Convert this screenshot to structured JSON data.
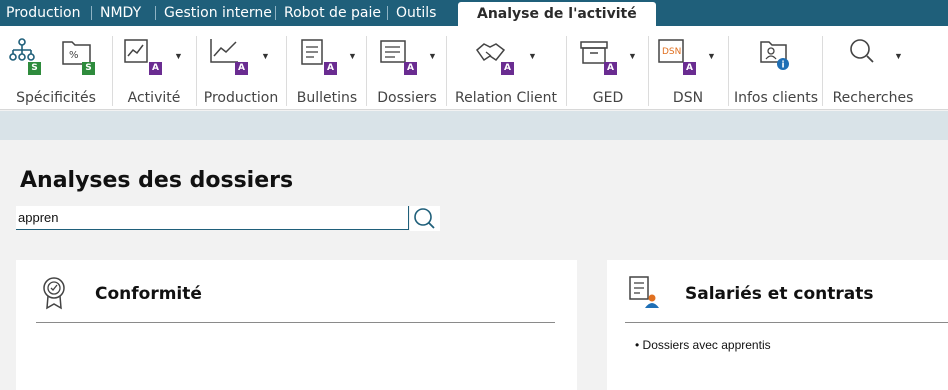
{
  "tabs": [
    {
      "label": "Production"
    },
    {
      "label": "NMDY"
    },
    {
      "label": "Gestion interne"
    },
    {
      "label": "Robot de paie"
    },
    {
      "label": "Outils"
    },
    {
      "label": "Analyse de l'activité",
      "active": true
    }
  ],
  "ribbon": {
    "groups": [
      {
        "label": "Spécificités",
        "icons": [
          "org-chart-icon",
          "percent-folder-icon"
        ],
        "badges": [
          "S",
          "S"
        ]
      },
      {
        "label": "Activité",
        "icons": [
          "activity-chart-icon"
        ],
        "badges": [
          "A"
        ]
      },
      {
        "label": "Production",
        "icons": [
          "line-chart-icon"
        ],
        "badges": [
          "A"
        ]
      },
      {
        "label": "Bulletins",
        "icons": [
          "payslip-icon"
        ],
        "badges": [
          "A"
        ]
      },
      {
        "label": "Dossiers",
        "icons": [
          "folder-list-icon"
        ],
        "badges": [
          "A"
        ]
      },
      {
        "label": "Relation Client",
        "icons": [
          "handshake-icon"
        ],
        "badges": [
          "A"
        ]
      },
      {
        "label": "GED",
        "icons": [
          "archive-box-icon"
        ],
        "badges": [
          "A"
        ]
      },
      {
        "label": "DSN",
        "icons": [
          "dsn-doc-icon"
        ],
        "badges": [
          "A"
        ],
        "icon_text": "DSN"
      },
      {
        "label": "Infos clients",
        "icons": [
          "client-folder-info-icon"
        ],
        "badges": []
      },
      {
        "label": "Recherches",
        "icons": [
          "search-icon"
        ],
        "badges": []
      }
    ]
  },
  "main": {
    "title": "Analyses des dossiers",
    "search": {
      "value": "appren",
      "placeholder": ""
    },
    "cards": [
      {
        "title": "Conformité",
        "icon": "award-ribbon-icon",
        "items": []
      },
      {
        "title": "Salariés et contrats",
        "icon": "employee-document-icon",
        "items": [
          "Dossiers avec apprentis"
        ]
      }
    ]
  },
  "colors": {
    "tabstrip": "#1f5f7a",
    "badge_s": "#2e8b3c",
    "badge_a": "#6a2c91",
    "band": "#d9e3e8",
    "icon_accent": "#1f5f7a"
  }
}
